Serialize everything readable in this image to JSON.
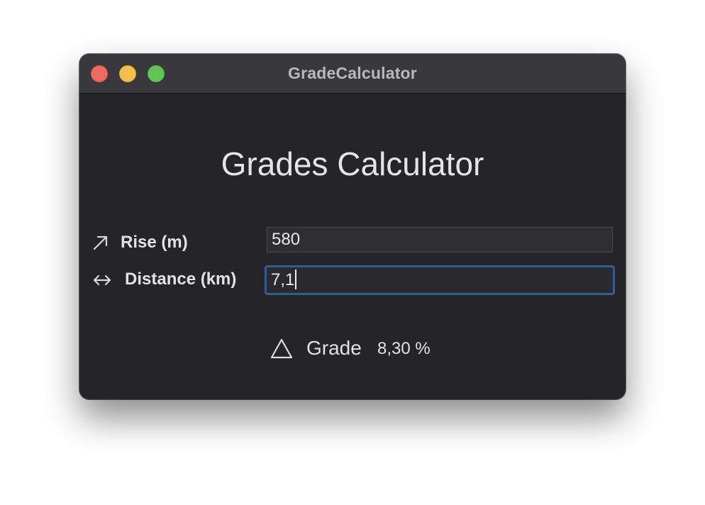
{
  "window": {
    "title": "GradeCalculator"
  },
  "main": {
    "heading": "Grades Calculator",
    "rise": {
      "icon": "arrow-up-right-icon",
      "label": "Rise (m)",
      "value": "580"
    },
    "distance": {
      "icon": "arrow-left-right-icon",
      "label": "Distance (km)",
      "value": "7,1"
    },
    "result": {
      "icon": "triangle-icon",
      "label": "Grade",
      "value": "8,30 %"
    }
  },
  "colors": {
    "window_background": "#252429",
    "titlebar_background": "#39383d",
    "focus_ring": "#2d5e97",
    "close_button": "#ec6a5e",
    "minimize_button": "#f4bf4f",
    "zoom_button": "#61c554"
  }
}
